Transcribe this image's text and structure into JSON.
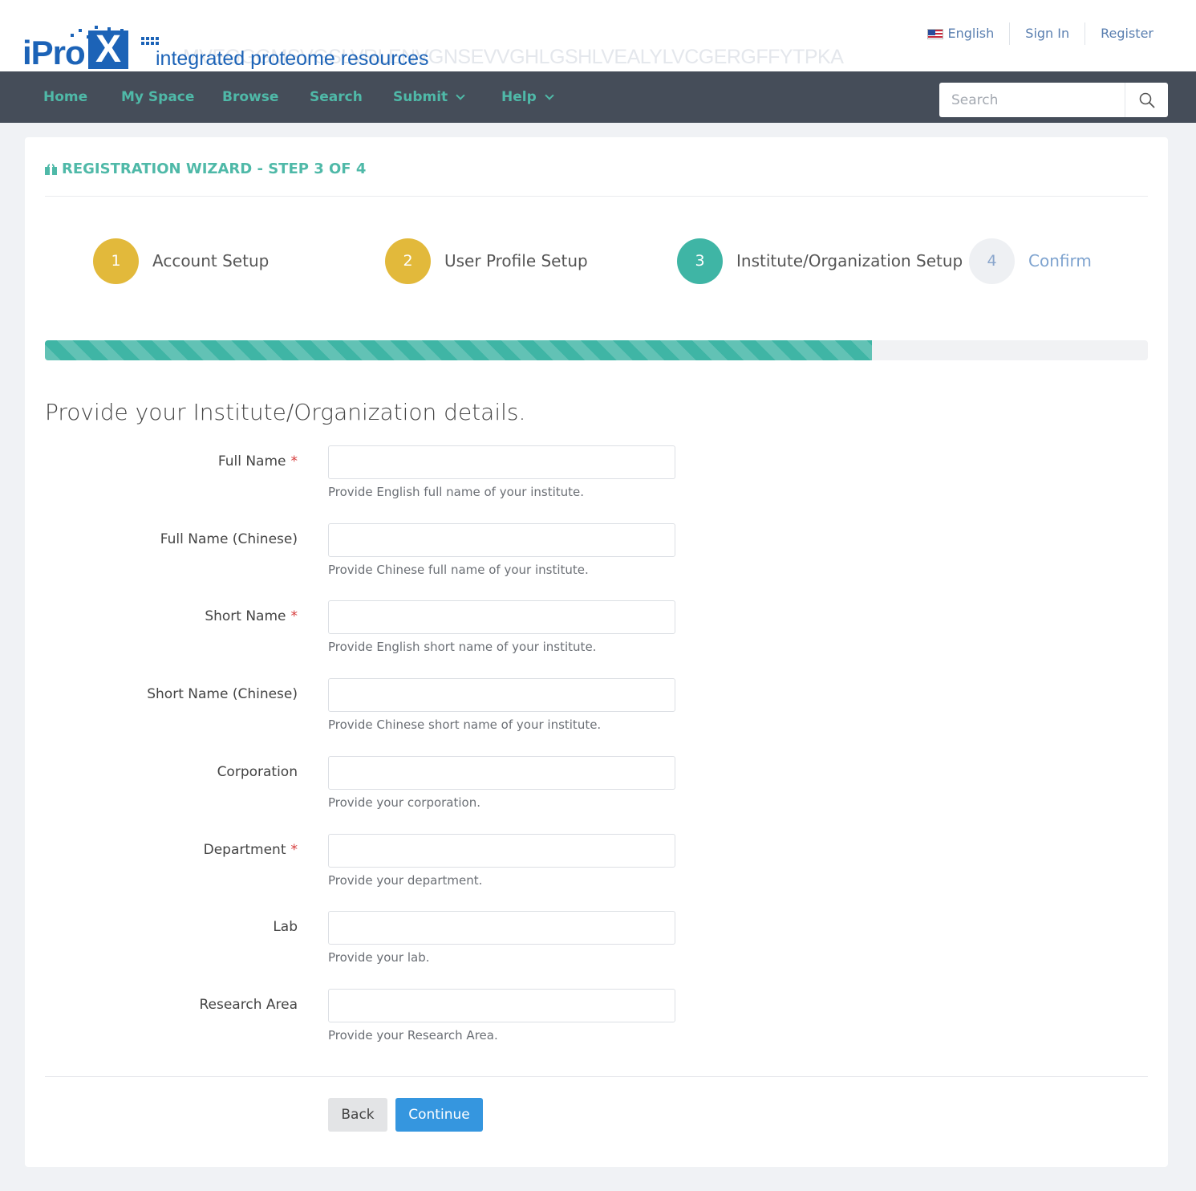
{
  "header": {
    "logo_text": "iPro",
    "logo_x": "X",
    "logo_tagline": "integrated proteome resources",
    "logo_sequence": "MVEGGGMSVGSLVRLENVGNSEVVGHLGSHLVEALYLVCGERGFFYTPKA",
    "language": "English",
    "sign_in": "Sign In",
    "register": "Register"
  },
  "nav": {
    "items": [
      "Home",
      "My Space",
      "Browse",
      "Search",
      "Submit",
      "Help"
    ],
    "search_placeholder": "Search"
  },
  "wizard": {
    "title": "REGISTRATION WIZARD - STEP 3 OF 4",
    "steps": [
      {
        "num": "1",
        "label": "Account Setup",
        "state": "done"
      },
      {
        "num": "2",
        "label": "User Profile Setup",
        "state": "done"
      },
      {
        "num": "3",
        "label": "Institute/Organization Setup",
        "state": "active"
      },
      {
        "num": "4",
        "label": "Confirm",
        "state": "todo"
      }
    ],
    "progress": 0.75,
    "colors": {
      "done": "#e2b93b",
      "active": "#3fb5a5",
      "accent": "#4fb9a8",
      "primary_button": "#3596df"
    }
  },
  "form": {
    "heading": "Provide your Institute/Organization details.",
    "required_mark": "*",
    "fields": [
      {
        "label": "Full Name",
        "required": true,
        "value": "",
        "help": "Provide English full name of your institute."
      },
      {
        "label": "Full Name (Chinese)",
        "required": false,
        "value": "",
        "help": "Provide Chinese full name of your institute."
      },
      {
        "label": "Short Name",
        "required": true,
        "value": "",
        "help": "Provide English short name of your institute."
      },
      {
        "label": "Short Name (Chinese)",
        "required": false,
        "value": "",
        "help": "Provide Chinese short name of your institute."
      },
      {
        "label": "Corporation",
        "required": false,
        "value": "",
        "help": "Provide your corporation."
      },
      {
        "label": "Department",
        "required": true,
        "value": "",
        "help": "Provide your department."
      },
      {
        "label": "Lab",
        "required": false,
        "value": "",
        "help": "Provide your lab."
      },
      {
        "label": "Research Area",
        "required": false,
        "value": "",
        "help": "Provide your Research Area."
      }
    ],
    "back_label": "Back",
    "continue_label": "Continue"
  },
  "icons": {
    "search": "search-icon",
    "gift": "gift-icon",
    "flag": "us-flag-icon",
    "chevron": "chevron-down-icon"
  }
}
